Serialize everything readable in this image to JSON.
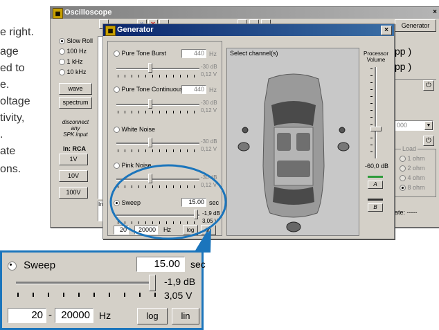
{
  "left_text": {
    "lines": [
      "e right.",
      "age",
      "ed to",
      "e.",
      "oltage",
      "tivity,",
      ".",
      "ate",
      "ons."
    ]
  },
  "oscilloscope": {
    "title": "Oscilloscope",
    "generator_button": "Generator",
    "sidebar": {
      "options": [
        "Slow Roll",
        "100 Hz",
        "1 kHz",
        "10 kHz"
      ],
      "selected": 0,
      "wave_button": "wave",
      "spectrum_button": "spectrum",
      "disconnect_note": [
        "disconnect",
        "any",
        "SPK input"
      ],
      "in_rca_label": "In: RCA",
      "range_buttons": [
        "1V",
        "10V",
        "100V"
      ]
    },
    "right_panel": {
      "readout_1": "pp )",
      "readout_2": "pp )",
      "combo_value": "000",
      "load_label": "Load",
      "load_options": [
        "1 ohm",
        "2 ohm",
        "4 ohm",
        "8 ohm"
      ],
      "load_selected": 3,
      "rate_text": "ate: -----"
    },
    "bottom_input_fragment": "Ins"
  },
  "generator": {
    "title": "Generator",
    "modes": [
      {
        "label": "Pure Tone Burst",
        "value": "440",
        "unit": "Hz",
        "db": "-30 dB",
        "volts": "0,12 V"
      },
      {
        "label": "Pure Tone Continuous",
        "value": "440",
        "unit": "Hz",
        "db": "-30 dB",
        "volts": "0,12 V"
      },
      {
        "label": "White Noise",
        "db": "-30 dB",
        "volts": "0,12 V"
      },
      {
        "label": "Pink Noise",
        "db": "-30 dB",
        "volts": "0,12 V"
      }
    ],
    "sweep": {
      "label": "Sweep",
      "value": "15.00",
      "unit": "sec",
      "db": "-1,9 dB",
      "volts": "3,05 V",
      "from": "20",
      "separator": "-",
      "to": "20000",
      "hz_label": "Hz",
      "log_button": "log",
      "lin_button": "lin"
    },
    "channel_label": "Select channel(s)",
    "processor_label": [
      "Processor",
      "Volume"
    ],
    "volume_readout": "-60,0 dB",
    "channel_a": "A",
    "channel_b": "B"
  },
  "zoom": {
    "label": "Sweep",
    "value": "15.00",
    "unit": "sec",
    "db": "-1,9 dB",
    "volts": "3,05 V",
    "from": "20",
    "separator": "-",
    "to": "20000",
    "hz_label": "Hz",
    "log_button": "log",
    "lin_button": "lin"
  },
  "colors": {
    "highlight": "#1b75bc",
    "titlebar_active": "#0a246a",
    "channel_green": "#2e9b3a"
  }
}
